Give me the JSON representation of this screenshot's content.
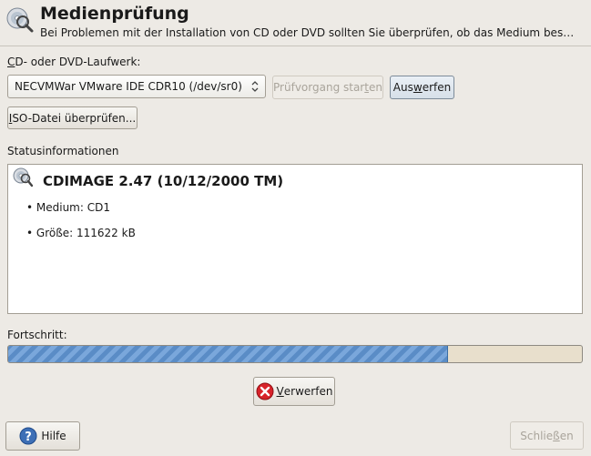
{
  "header": {
    "title": "Medienprüfung",
    "description": "Bei Problemen mit der Installation von CD oder DVD sollten Sie überprüfen, ob das Medium bes…"
  },
  "drive": {
    "label_key": "C",
    "label_rest": "D- oder DVD-Laufwerk:",
    "selected": "NECVMWar VMware IDE CDR10 (/dev/sr0)"
  },
  "buttons": {
    "start_pre": "Prüfvorgang star",
    "start_key": "t",
    "start_post": "en",
    "eject_pre": "Aus",
    "eject_key": "w",
    "eject_post": "erfen",
    "iso_key": "I",
    "iso_rest": "SO-Datei überprüfen...",
    "discard_key": "V",
    "discard_rest": "erwerfen",
    "help": "Hilfe",
    "close_pre": "Schlie",
    "close_key": "ß",
    "close_post": "en"
  },
  "status": {
    "label": "Statusinformationen",
    "title": "CDIMAGE 2.47 (10/12/2000 TM)",
    "items": [
      "• Medium: CD1",
      "• Größe: 111622 kB"
    ]
  },
  "progress": {
    "label": "Fortschritt:",
    "fraction": 0.765
  }
}
